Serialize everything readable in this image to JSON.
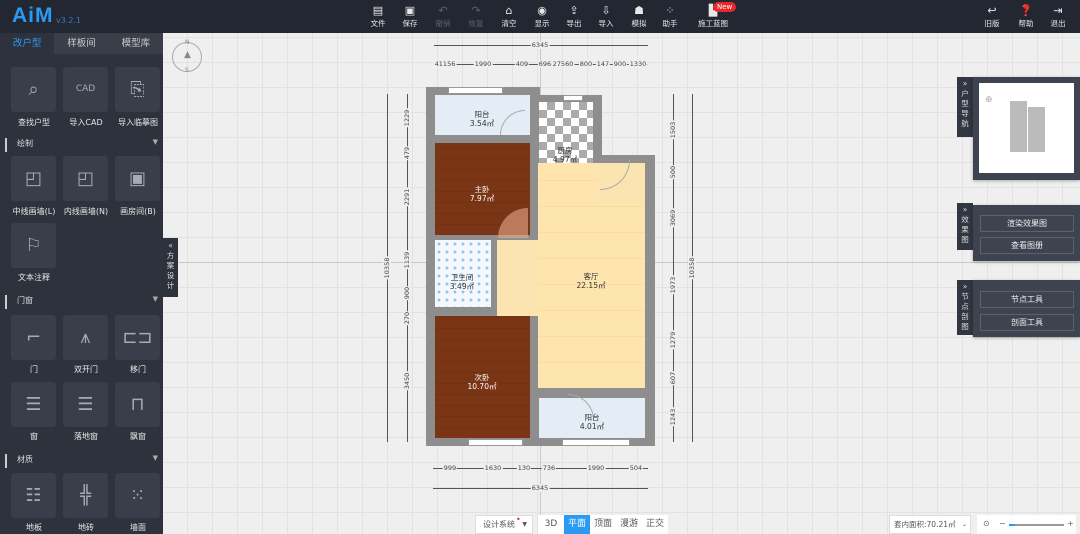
{
  "app": {
    "logo": "AiM",
    "version": "v3.2.1"
  },
  "toolbar": [
    {
      "label": "文件",
      "icon": "file-icon",
      "enabled": true
    },
    {
      "label": "保存",
      "icon": "save-icon",
      "enabled": true
    },
    {
      "label": "撤销",
      "icon": "undo-icon",
      "enabled": false
    },
    {
      "label": "恢复",
      "icon": "redo-icon",
      "enabled": false
    },
    {
      "label": "清空",
      "icon": "broom-icon",
      "enabled": true
    },
    {
      "label": "显示",
      "icon": "eye-icon",
      "enabled": true
    },
    {
      "label": "导出",
      "icon": "export-icon",
      "enabled": true
    },
    {
      "label": "导入",
      "icon": "import-icon",
      "enabled": true
    },
    {
      "label": "模拟",
      "icon": "worker-icon",
      "enabled": true
    },
    {
      "label": "助手",
      "icon": "grid-icon",
      "enabled": true
    },
    {
      "label": "施工蓝图",
      "icon": "blueprint-icon",
      "enabled": true,
      "badge": "New"
    }
  ],
  "toolbar_right": [
    {
      "label": "旧版",
      "icon": "back-icon"
    },
    {
      "label": "帮助",
      "icon": "help-icon"
    },
    {
      "label": "退出",
      "icon": "logout-icon"
    }
  ],
  "left_tabs": [
    "改户型",
    "样板间",
    "模型库"
  ],
  "top_tools": [
    "查找户型",
    "导入CAD",
    "导入临摹图"
  ],
  "cad_icon_text": "CAD",
  "sections": {
    "draw": {
      "title": "绘制",
      "items": [
        "中线画墙(L)",
        "内线画墙(N)",
        "画房间(B)",
        "文本注释"
      ]
    },
    "doors": {
      "title": "门窗",
      "items": [
        "门",
        "双开门",
        "移门",
        "窗",
        "落地窗",
        "飘窗"
      ]
    },
    "materials": {
      "title": "材质",
      "items": [
        "地板",
        "地砖",
        "墙面"
      ]
    }
  },
  "side_tab": "方案设计",
  "compass": {
    "n": "N",
    "s": "S"
  },
  "rooms": [
    {
      "name": "阳台",
      "area": "3.54㎡",
      "floor": "#e4edf6"
    },
    {
      "name": "主卧",
      "area": "7.97㎡",
      "floor": "#7a3416"
    },
    {
      "name": "厨房",
      "area": "4.97㎡",
      "floor": "checker"
    },
    {
      "name": "卫生间",
      "area": "3.49㎡",
      "floor": "#f4f8fc"
    },
    {
      "name": "客厅",
      "area": "22.15㎡",
      "floor": "#fde5ad"
    },
    {
      "name": "次卧",
      "area": "10.70㎡",
      "floor": "#7a3416"
    },
    {
      "name": "阳台",
      "area": "4.01㎡",
      "floor": "#e4edf6"
    }
  ],
  "dimensions": {
    "top_total": "6345",
    "top": [
      "41156",
      "1990",
      "409",
      "696",
      "27560",
      "800",
      "147",
      "900",
      "1330"
    ],
    "left_total": "10358",
    "left": [
      "1229",
      "479",
      "2291",
      "1139",
      "900",
      "270",
      "3450"
    ],
    "right_total": "10358",
    "right": [
      "1503",
      "500",
      "3069",
      "1973",
      "1279",
      "607",
      "1243"
    ],
    "bottom": [
      "999",
      "1630",
      "130",
      "736",
      "1990",
      "504"
    ],
    "bottom_total": "6345"
  },
  "right_panels": {
    "nav": {
      "tab": "户型导航"
    },
    "render": {
      "tab": "效果图",
      "buttons": [
        "渲染效果图",
        "查看图册"
      ]
    },
    "node": {
      "tab": "节点剖图",
      "buttons": [
        "节点工具",
        "剖面工具"
      ]
    }
  },
  "bottom": {
    "design_system": "设计系统",
    "views": [
      "3D",
      "平面",
      "顶面",
      "漫游",
      "正交"
    ],
    "active_view": "平面",
    "area_label": "套内面积:70.21㎡",
    "zoom_level": 0.1
  },
  "colors": {
    "accent": "#2b9af3",
    "panel": "#2e323d",
    "badge": "#e8262c"
  }
}
